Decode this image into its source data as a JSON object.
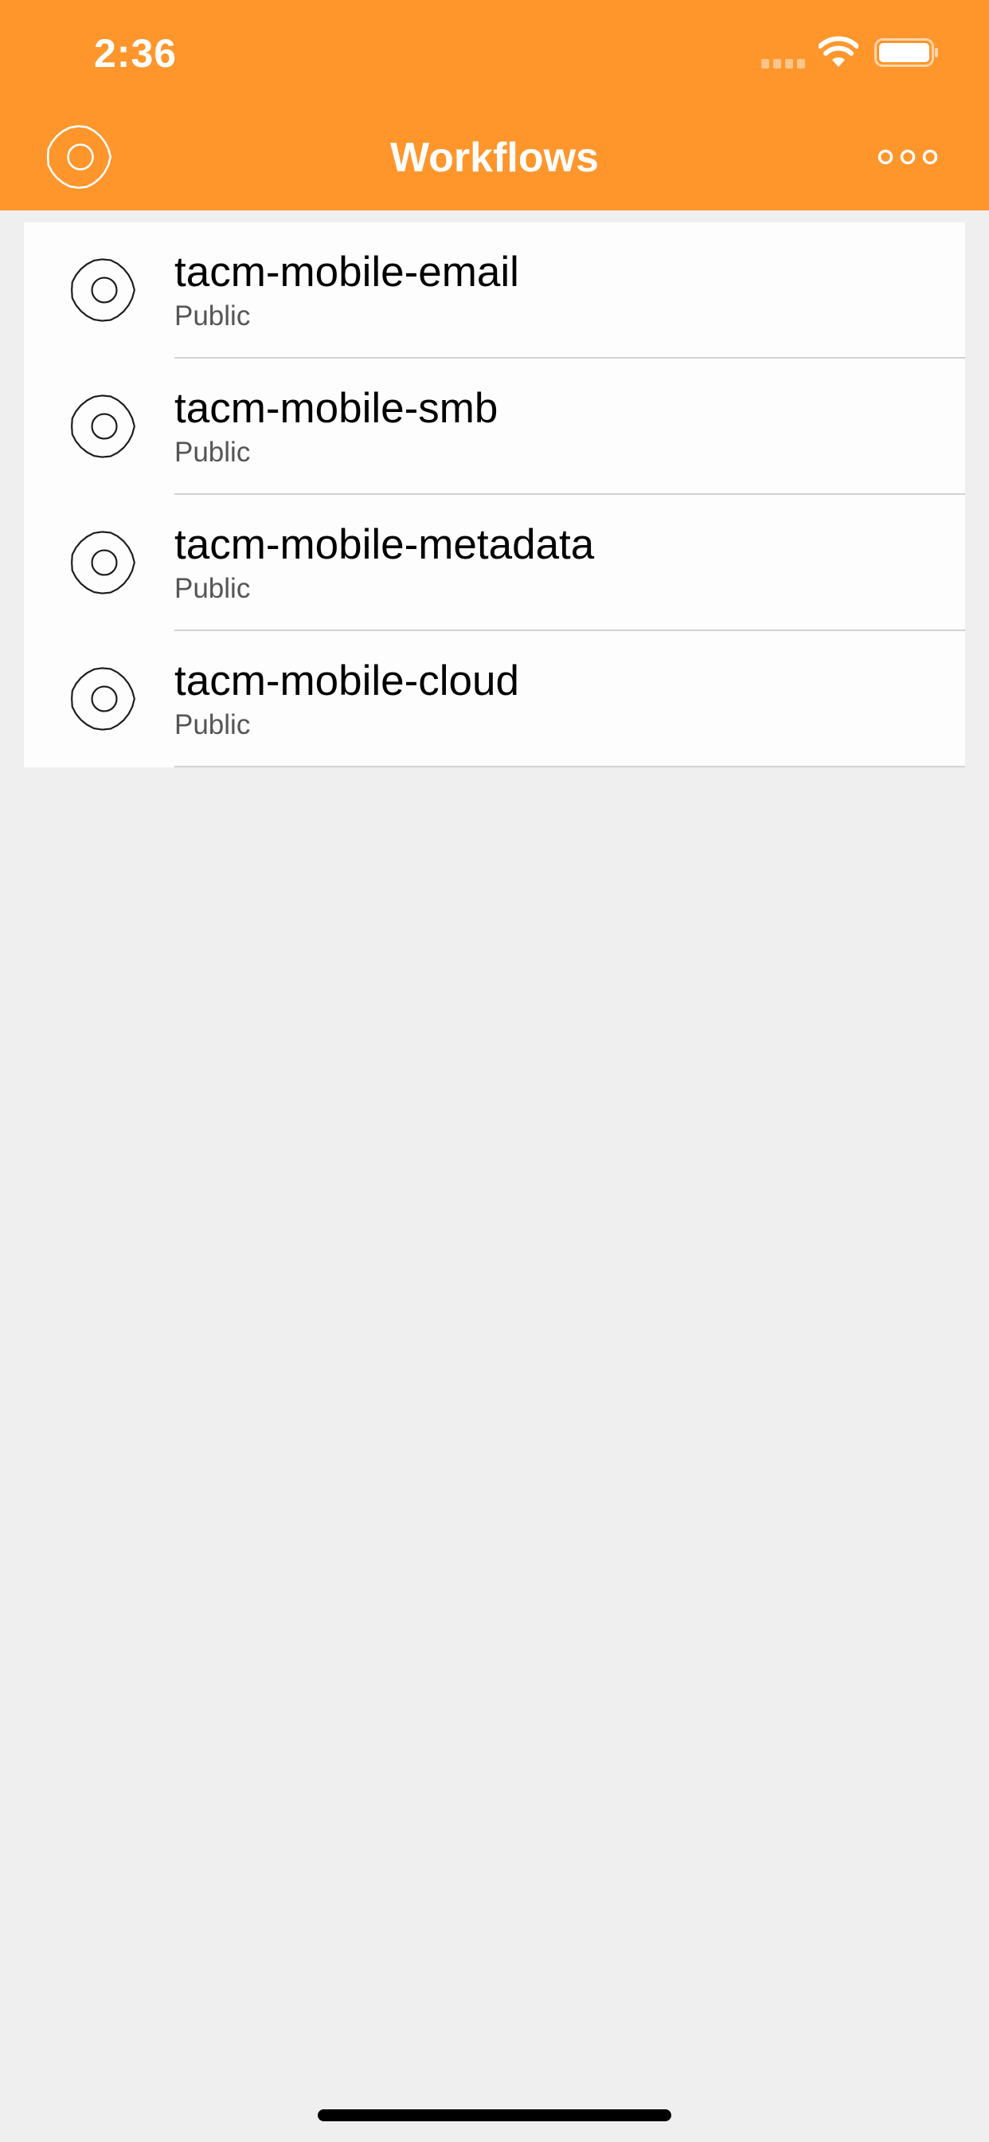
{
  "status_bar": {
    "time": "2:36"
  },
  "nav": {
    "title": "Workflows",
    "left_icon": "gear-icon",
    "right_icon": "more-icon"
  },
  "colors": {
    "header": "#FF962C",
    "background": "#EFEFEF",
    "row_background": "#FDFDFD"
  },
  "workflows": [
    {
      "name": "tacm-mobile-email",
      "visibility": "Public",
      "icon": "gear-icon"
    },
    {
      "name": "tacm-mobile-smb",
      "visibility": "Public",
      "icon": "gear-icon"
    },
    {
      "name": "tacm-mobile-metadata",
      "visibility": "Public",
      "icon": "gear-icon"
    },
    {
      "name": "tacm-mobile-cloud",
      "visibility": "Public",
      "icon": "gear-icon"
    }
  ]
}
